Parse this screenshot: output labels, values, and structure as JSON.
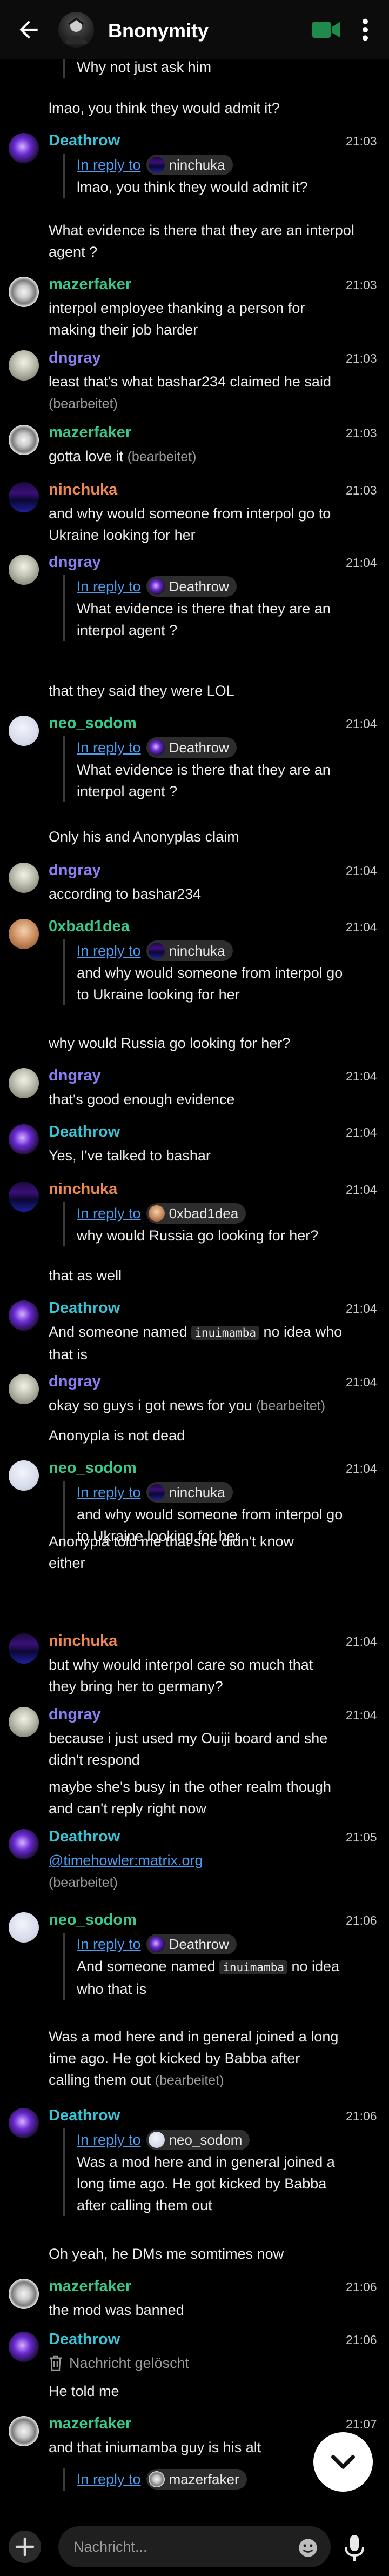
{
  "header": {
    "title": "Bnonymity",
    "icons": [
      "back-arrow-icon",
      "video-call-icon",
      "more-vert-icon"
    ]
  },
  "colors": {
    "Deathrow": "#36c5d6",
    "mazerfaker": "#37c98b",
    "dngray": "#8b80f2",
    "ninchuka": "#f0884c",
    "neo_sodom": "#37c98b",
    "0xbad1dea": "#37c98b",
    "link": "#4a9cf0",
    "background": "#000000"
  },
  "messages": [
    {
      "text": "Why not just ask him"
    },
    {
      "text": "lmao, you think they would admit it?"
    },
    {
      "sender": "Deathrow",
      "time": "21:03",
      "reply_label": "In reply to",
      "reply_to": "ninchuka",
      "reply_text": "lmao, you think they would admit it?"
    },
    {
      "text": "What evidence is there that they are an interpol agent ?"
    },
    {
      "sender": "mazerfaker",
      "time": "21:03",
      "text": "interpol employee thanking a person for making their job harder"
    },
    {
      "sender": "dngray",
      "time": "21:03",
      "text": "least that's what bashar234 claimed he said",
      "edited": "(bearbeitet)"
    },
    {
      "sender": "mazerfaker",
      "time": "21:03",
      "text": "gotta love it",
      "edited": "(bearbeitet)"
    },
    {
      "sender": "ninchuka",
      "time": "21:03",
      "text": "and why would someone from interpol go to Ukraine looking for her"
    },
    {
      "sender": "dngray",
      "time": "21:04",
      "reply_label": "In reply to",
      "reply_to": "Deathrow",
      "reply_text": "What evidence is there that they are an interpol agent ?"
    },
    {
      "text": "that they said they were LOL"
    },
    {
      "sender": "neo_sodom",
      "time": "21:04",
      "reply_label": "In reply to",
      "reply_to": "Deathrow",
      "reply_text": "What evidence is there that they are an interpol agent ?"
    },
    {
      "text": "Only his and Anonyplas claim"
    },
    {
      "sender": "dngray",
      "time": "21:04",
      "text": "according to bashar234"
    },
    {
      "sender": "0xbad1dea",
      "time": "21:04",
      "reply_label": "In reply to",
      "reply_to": "ninchuka",
      "reply_text": "and why would someone from interpol go to Ukraine looking for her"
    },
    {
      "text": "why would Russia go looking for her?"
    },
    {
      "sender": "dngray",
      "time": "21:04",
      "text": "that's good enough evidence"
    },
    {
      "sender": "Deathrow",
      "time": "21:04",
      "text": "Yes, I've talked to bashar"
    },
    {
      "sender": "ninchuka",
      "time": "21:04",
      "reply_label": "In reply to",
      "reply_to": "0xbad1dea",
      "reply_text": "why would Russia go looking for her?"
    },
    {
      "text": "that as well"
    },
    {
      "sender": "Deathrow",
      "time": "21:04",
      "text_before": "And someone named",
      "code": "inuimamba",
      "text_after": "no idea who that is"
    },
    {
      "sender": "dngray",
      "time": "21:04",
      "text": "okay so guys i got news for you",
      "edited": "(bearbeitet)"
    },
    {
      "text": "Anonypla is not dead"
    },
    {
      "sender": "neo_sodom",
      "time": "21:04",
      "reply_label": "In reply to",
      "reply_to": "ninchuka",
      "reply_text": "and why would someone from interpol go to Ukraine looking for her"
    },
    {
      "text": "Anonypla told me that she didn't know either"
    },
    {
      "sender": "ninchuka",
      "time": "21:04",
      "text": "but why would interpol care so much that they bring her to germany?"
    },
    {
      "sender": "dngray",
      "time": "21:04",
      "text": "because i just used my Ouiji board and she didn't respond"
    },
    {
      "text": "maybe she's busy in the other realm though and can't reply right now"
    },
    {
      "sender": "Deathrow",
      "time": "21:05",
      "link": "@timehowler:matrix.org",
      "edited": "(bearbeitet)"
    },
    {
      "sender": "neo_sodom",
      "time": "21:06",
      "reply_label": "In reply to",
      "reply_to": "Deathrow",
      "reply_text_before": "And someone named",
      "reply_code": "inuimamba",
      "reply_text_after": "no idea who that is"
    },
    {
      "text": "Was a mod here and in general joined a long time ago. He got kicked by Babba after calling them out",
      "edited": "(bearbeitet)"
    },
    {
      "sender": "Deathrow",
      "time": "21:06",
      "reply_label": "In reply to",
      "reply_to": "neo_sodom",
      "reply_text": "Was a mod here and in general joined a long time ago. He got kicked by Babba after calling them out"
    },
    {
      "text": "Oh yeah, he DMs me somtimes now"
    },
    {
      "sender": "mazerfaker",
      "time": "21:06",
      "text": "the mod was banned"
    },
    {
      "sender": "Deathrow",
      "time": "21:06",
      "deleted": "Nachricht gelöscht"
    },
    {
      "text": "He told me"
    },
    {
      "sender": "mazerfaker",
      "time": "21:07",
      "text": "and that iniumamba guy is his alt"
    },
    {
      "reply_label": "In reply to",
      "reply_to": "mazerfaker"
    }
  ],
  "composer": {
    "placeholder": "Nachricht..."
  }
}
